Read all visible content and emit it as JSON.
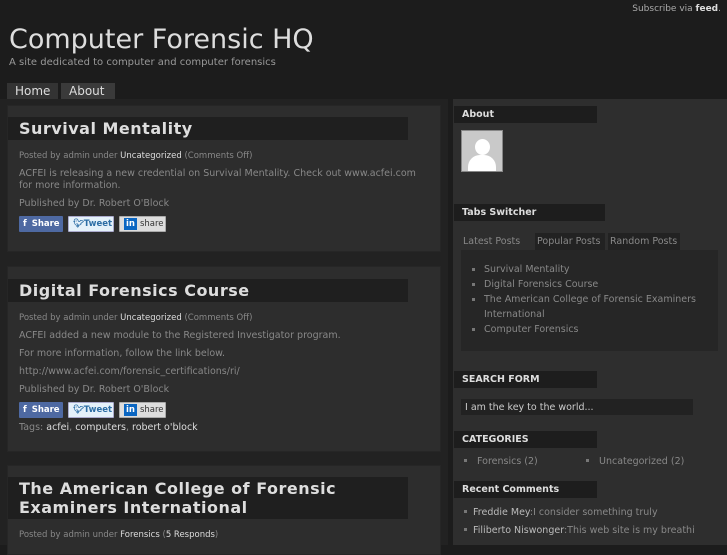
{
  "header": {
    "subscribe_text": "Subscribe via",
    "subscribe_link": "feed",
    "title": "Computer Forensic HQ",
    "tagline": "A site dedicated to computer and computer forensics"
  },
  "nav": [
    {
      "label": "Home"
    },
    {
      "label": "About"
    }
  ],
  "posts": [
    {
      "title": "Survival Mentality",
      "meta_prefix": "Posted by admin under",
      "category": "Uncategorized",
      "comments": "(Comments Off)",
      "paragraphs": [
        "ACFEI is releasing a new credential on Survival Mentality. Check out www.acfei.com for more information.",
        "Published by Dr. Robert O'Block"
      ]
    },
    {
      "title": "Digital Forensics Course",
      "meta_prefix": "Posted by admin under",
      "category": "Uncategorized",
      "comments": "(Comments Off)",
      "paragraphs": [
        "ACFEI added a new module to the Registered Investigator program.",
        "For more information, follow the link below.",
        "http://www.acfei.com/forensic_certifications/ri/",
        "Published by Dr. Robert O'Block"
      ],
      "tags_label": "Tags:",
      "tags": [
        "acfei",
        "computers",
        "robert o'block"
      ]
    },
    {
      "title": "The American College of Forensic Examiners International",
      "meta_prefix": "Posted by admin under",
      "category": "Forensics",
      "comments_open": "(",
      "comments": "5 Responds",
      "comments_close": ")"
    }
  ],
  "share": {
    "facebook": "Share",
    "twitter": "Tweet",
    "linkedin": "share"
  },
  "sidebar": {
    "about_title": "About",
    "tabs_title": "Tabs Switcher",
    "tabs": [
      "Latest Posts",
      "Popular Posts",
      "Random Posts"
    ],
    "latest_posts": [
      "Survival Mentality",
      "Digital Forensics Course",
      "The American College of Forensic Examiners International",
      "Computer Forensics"
    ],
    "search_title": "SEARCH FORM",
    "search_value": "I am the key to the world...",
    "categories_title": "CATEGORIES",
    "categories": [
      {
        "name": "Forensics",
        "count": "(2)"
      },
      {
        "name": "Uncategorized",
        "count": "(2)"
      }
    ],
    "comments_title": "Recent Comments",
    "comments": [
      {
        "author": "Freddie Mey",
        "text": "I consider something truly"
      },
      {
        "author": "Filiberto Niswonger",
        "text": "This web site is my breathi"
      }
    ]
  }
}
